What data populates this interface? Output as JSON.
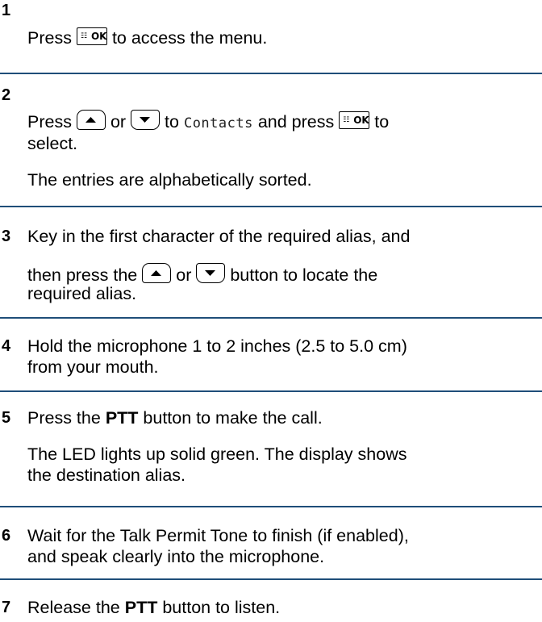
{
  "steps": [
    {
      "number": "1",
      "t1": "Press",
      "t2": "to access the menu."
    },
    {
      "number": "2",
      "t1": "Press",
      "t2": "or",
      "t3": "to",
      "menu_item": "Contacts",
      "t4": "and press",
      "t5": "to",
      "t6": "select.",
      "note": "The entries are alphabetically sorted."
    },
    {
      "number": "3",
      "line1": "Key in the first character of the required alias, and",
      "t1": "then press the",
      "t2": "or",
      "t3": "button to locate the",
      "line3": "required alias."
    },
    {
      "number": "4",
      "line1": "Hold the microphone 1 to 2 inches (2.5 to 5.0 cm)",
      "line2": "from your mouth."
    },
    {
      "number": "5",
      "t1": "Press the",
      "ptt": "PTT",
      "t2": "button to make the call.",
      "note_line1": "The LED lights up solid green. The display shows",
      "note_line2": "the destination alias."
    },
    {
      "number": "6",
      "line1": "Wait for the Talk Permit Tone to finish (if enabled),",
      "line2": "and speak clearly into the microphone."
    },
    {
      "number": "7",
      "t1": "Release the",
      "ptt": "PTT",
      "t2": "button to listen."
    }
  ],
  "keys": {
    "ok_label": "OK",
    "ok_glyph": "☷",
    "up_icon": "up-arrow-key-icon",
    "down_icon": "down-arrow-key-icon"
  },
  "colors": {
    "rule": "#1f4e79"
  }
}
